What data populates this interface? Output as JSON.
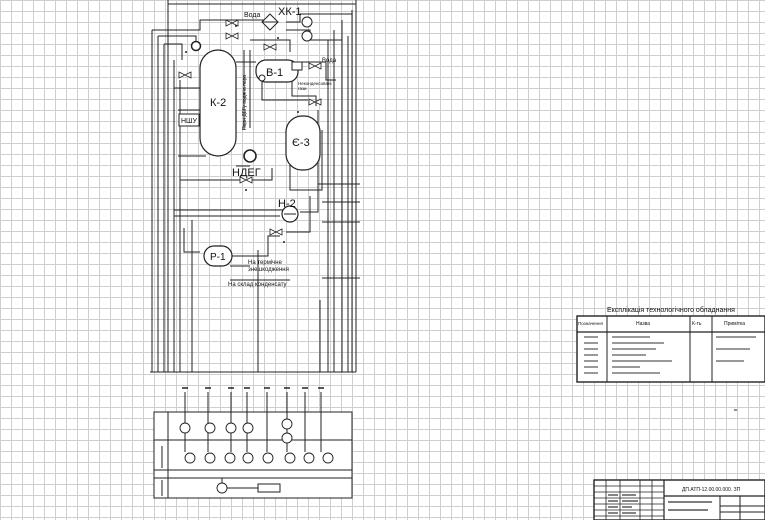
{
  "schematic": {
    "equipment": {
      "column": "К-2",
      "condenser": "ХК-1",
      "separator": "В-1",
      "vessel": "Є-3",
      "pump_main": "НДЕГ",
      "pump_small": "НШУ",
      "pump_h2": "Н-2",
      "tank": "Р-1"
    },
    "streams": {
      "water_top": "Вода",
      "water_right": "Вода",
      "steam_label": "Пари ДЕГу водяна пара",
      "separator_note_1": "Неконденсовані",
      "separator_note_2": "гази",
      "dehydration_1": "На термічне",
      "dehydration_2": "знешкодження",
      "to_storage": "На склад конденсату"
    }
  },
  "explication": {
    "title": "Експлікація технологічного обладнання",
    "headers": [
      "Позначення",
      "Назва",
      "К-ть",
      "Примітка"
    ]
  },
  "titleblock": {
    "code": "ДП.АТП-12.00.00.000. ЗП"
  }
}
